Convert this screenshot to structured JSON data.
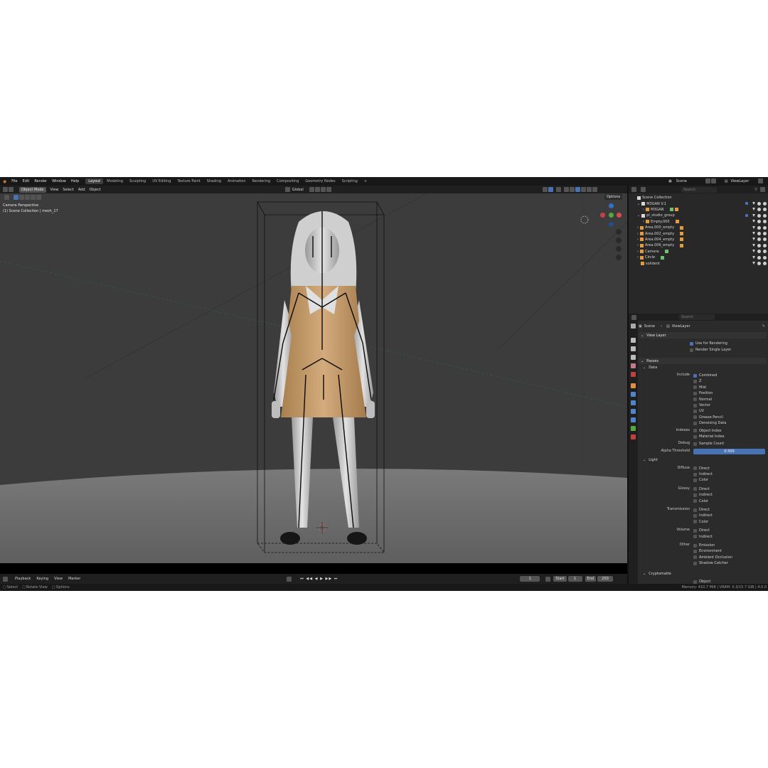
{
  "menu": {
    "items": [
      "File",
      "Edit",
      "Render",
      "Window",
      "Help"
    ],
    "workspaces": [
      "Layout",
      "Modeling",
      "Sculpting",
      "UV Editing",
      "Texture Paint",
      "Shading",
      "Animation",
      "Rendering",
      "Compositing",
      "Geometry Nodes",
      "Scripting"
    ],
    "add_tab": "+",
    "scene_label": "Scene",
    "viewlayer_label": "ViewLayer"
  },
  "viewport_header": {
    "mode": "Object Mode",
    "menus": [
      "View",
      "Select",
      "Add",
      "Object"
    ],
    "orientation": "Global",
    "options": "Options"
  },
  "viewport": {
    "view_name": "Camera Perspective",
    "collection_info": "(1) Scene Collection | mesh_17"
  },
  "outliner": {
    "search_placeholder": "Search",
    "rows": [
      {
        "label": "Scene Collection",
        "indent": 0
      },
      {
        "label": "M3GAN V.1",
        "indent": 1
      },
      {
        "label": "M3GAN",
        "indent": 2
      },
      {
        "label": "pl_studio_group",
        "indent": 1
      },
      {
        "label": "Empty.000",
        "indent": 2
      },
      {
        "label": "Area.000_empty",
        "indent": 1
      },
      {
        "label": "Area.002_empty",
        "indent": 1
      },
      {
        "label": "Area.004_empty",
        "indent": 1
      },
      {
        "label": "Area.006_empty",
        "indent": 1
      },
      {
        "label": "Camera",
        "indent": 1
      },
      {
        "label": "Circle",
        "indent": 1
      },
      {
        "label": "solident",
        "indent": 1
      }
    ]
  },
  "properties": {
    "search_placeholder": "Search",
    "breadcrumb": [
      "Scene",
      "ViewLayer"
    ],
    "view_layer": {
      "title": "View Layer",
      "use_for_rendering": "Use for Rendering",
      "render_single_layer": "Render Single Layer"
    },
    "passes": {
      "title": "Passes",
      "data_title": "Data",
      "include_label": "Include",
      "include": [
        "Combined",
        "Z",
        "Mist",
        "Position",
        "Normal",
        "Vector",
        "UV",
        "Grease Pencil",
        "Denoising Data"
      ],
      "indexes_label": "Indexes",
      "indexes": [
        "Object Index",
        "Material Index"
      ],
      "debug_label": "Debug",
      "debug": [
        "Sample Count"
      ],
      "alpha_label": "Alpha Threshold",
      "alpha_value": "0.500",
      "light_title": "Light",
      "diffuse_label": "Diffuse",
      "diffuse": [
        "Direct",
        "Indirect",
        "Color"
      ],
      "glossy_label": "Glossy",
      "glossy": [
        "Direct",
        "Indirect",
        "Color"
      ],
      "transmission_label": "Transmission",
      "transmission": [
        "Direct",
        "Indirect",
        "Color"
      ],
      "volume_label": "Volume",
      "volume": [
        "Direct",
        "Indirect"
      ],
      "other_label": "Other",
      "other": [
        "Emission",
        "Environment",
        "Ambient Occlusion",
        "Shadow Catcher"
      ],
      "cryptomatte_title": "Cryptomatte",
      "cryptomatte_first": "Object"
    }
  },
  "timeline": {
    "menus": [
      "Playback",
      "Keying",
      "View",
      "Marker"
    ],
    "current_frame": "1",
    "start_label": "Start",
    "start_value": "1",
    "end_label": "End",
    "end_value": "250"
  },
  "status": {
    "select": "Select",
    "rotate": "Rotate View",
    "options": "Options",
    "memory": "Memory: 410.7 MiB | VRAM: 0.3/15.7 GiB | 4.0.0"
  },
  "colors": {
    "accent": "#4772b3",
    "viewport_bg": "#3d3d3d",
    "floor": "#6e6e6e",
    "dress": "#c9a072"
  }
}
